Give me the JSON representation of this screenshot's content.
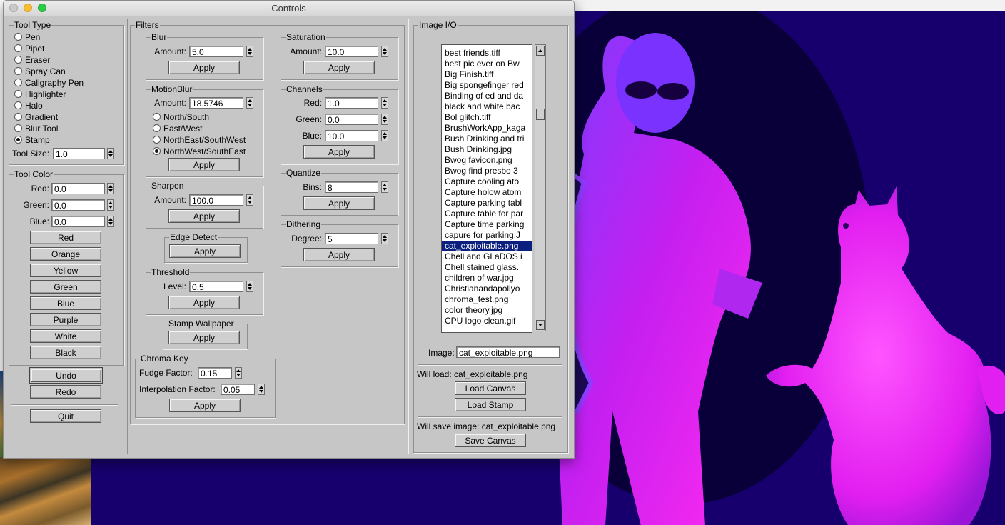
{
  "window": {
    "title": "Controls"
  },
  "tool_type": {
    "legend": "Tool Type",
    "options": [
      "Pen",
      "Pipet",
      "Eraser",
      "Spray Can",
      "Caligraphy Pen",
      "Highlighter",
      "Halo",
      "Gradient",
      "Blur Tool",
      "Stamp"
    ],
    "selected": "Stamp",
    "size_label": "Tool Size:",
    "size_value": "1.0"
  },
  "tool_color": {
    "legend": "Tool Color",
    "red_label": "Red:",
    "red_value": "0.0",
    "green_label": "Green:",
    "green_value": "0.0",
    "blue_label": "Blue:",
    "blue_value": "0.0",
    "buttons": [
      "Red",
      "Orange",
      "Yellow",
      "Green",
      "Blue",
      "Purple",
      "White",
      "Black"
    ]
  },
  "actions": {
    "undo": "Undo",
    "redo": "Redo",
    "quit": "Quit"
  },
  "filters": {
    "legend": "Filters",
    "blur": {
      "legend": "Blur",
      "label": "Amount:",
      "value": "5.0",
      "apply": "Apply"
    },
    "motion_blur": {
      "legend": "MotionBlur",
      "label": "Amount:",
      "value": "18.5746",
      "directions": [
        "North/South",
        "East/West",
        "NorthEast/SouthWest",
        "NorthWest/SouthEast"
      ],
      "selected": "NorthWest/SouthEast",
      "apply": "Apply"
    },
    "sharpen": {
      "legend": "Sharpen",
      "label": "Amount:",
      "value": "100.0",
      "apply": "Apply"
    },
    "edge_detect": {
      "legend": "Edge Detect",
      "apply": "Apply"
    },
    "threshold": {
      "legend": "Threshold",
      "label": "Level:",
      "value": "0.5",
      "apply": "Apply"
    },
    "stamp_wallpaper": {
      "legend": "Stamp Wallpaper",
      "apply": "Apply"
    },
    "chroma_key": {
      "legend": "Chroma Key",
      "fudge_label": "Fudge Factor:",
      "fudge_value": "0.15",
      "interp_label": "Interpolation Factor:",
      "interp_value": "0.05",
      "apply": "Apply"
    },
    "saturation": {
      "legend": "Saturation",
      "label": "Amount:",
      "value": "10.0",
      "apply": "Apply"
    },
    "channels": {
      "legend": "Channels",
      "red_label": "Red:",
      "red_value": "1.0",
      "green_label": "Green:",
      "green_value": "0.0",
      "blue_label": "Blue:",
      "blue_value": "10.0",
      "apply": "Apply"
    },
    "quantize": {
      "legend": "Quantize",
      "label": "Bins:",
      "value": "8",
      "apply": "Apply"
    },
    "dithering": {
      "legend": "Dithering",
      "label": "Degree:",
      "value": "5",
      "apply": "Apply"
    }
  },
  "image_io": {
    "legend": "Image I/O",
    "files": [
      "best friends.tiff",
      "best pic ever on Bw",
      "Big Finish.tiff",
      "Big spongefinger red",
      "Binding of ed and da",
      "black and white bac",
      "Bol glitch.tiff",
      "BrushWorkApp_kaga",
      "Bush Drinking and tri",
      "Bush Drinking.jpg",
      "Bwog favicon.png",
      "Bwog find presbo 3",
      "Capture cooling ato",
      "Capture holow atom",
      "Capture parking tabl",
      "Capture table for par",
      "Capture time parking",
      "capure for parking.J",
      "cat_exploitable.png",
      "Chell and GLaDOS i",
      "Chell stained glass.",
      "children of war.jpg",
      "Christianandapollyo",
      "chroma_test.png",
      "color theory.jpg",
      "CPU logo clean.gif"
    ],
    "selected_file": "cat_exploitable.png",
    "image_label": "Image:",
    "image_value": "cat_exploitable.png",
    "will_load": "Will load: cat_exploitable.png",
    "load_canvas": "Load Canvas",
    "load_stamp": "Load Stamp",
    "will_save": "Will save image: cat_exploitable.png",
    "save_canvas": "Save Canvas"
  },
  "colors": {
    "canvas_bg": "#17006e",
    "figure_magenta": "#e020f0",
    "figure_violet": "#6a2cff",
    "list_selection": "#0a1f7e",
    "panel_bg": "#c6c6c6"
  }
}
